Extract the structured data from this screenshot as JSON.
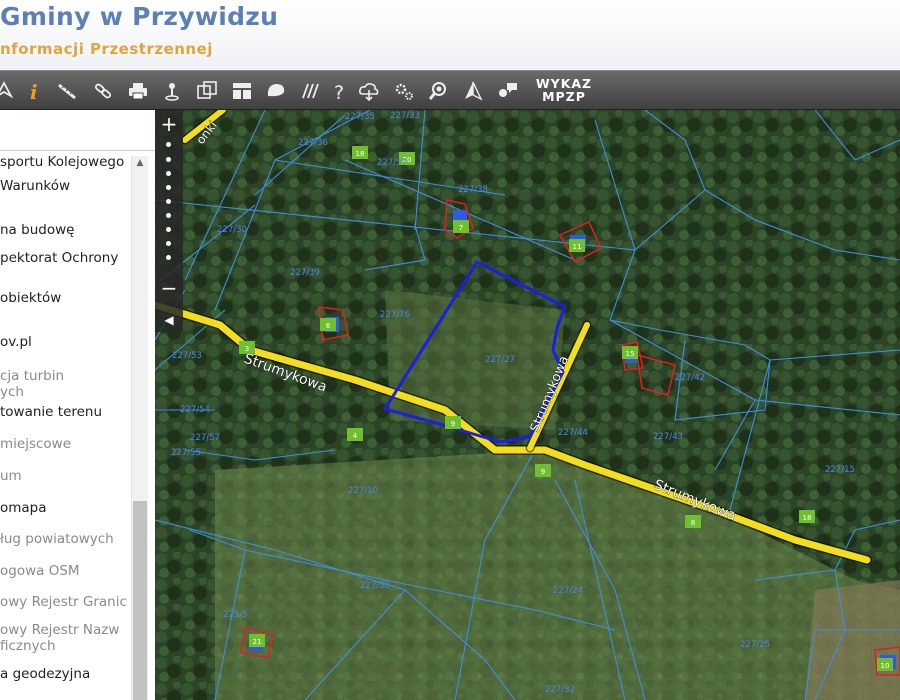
{
  "header": {
    "title": "Gminy w Przywidzu",
    "subtitle": "nformacji Przestrzennej"
  },
  "toolbar": {
    "tools": [
      {
        "name": "pan-icon"
      },
      {
        "name": "info-icon"
      },
      {
        "name": "measure-icon"
      },
      {
        "name": "link-icon"
      },
      {
        "name": "print-icon"
      },
      {
        "name": "pin-icon"
      },
      {
        "name": "copy-map-icon"
      },
      {
        "name": "layout-icon"
      },
      {
        "name": "shape-icon"
      },
      {
        "name": "hatch-icon"
      },
      {
        "name": "help-icon"
      },
      {
        "name": "cloud-download-icon"
      },
      {
        "name": "settings-icon"
      },
      {
        "name": "search-zoom-icon"
      },
      {
        "name": "north-arrow-icon"
      },
      {
        "name": "chat-icon"
      }
    ],
    "wykaz_label_1": "WYKAZ",
    "wykaz_label_2": "MPZP"
  },
  "sidebar": {
    "layers": [
      {
        "text": "sportu Kolejowego",
        "dim": false
      },
      {
        "text": "Warunków",
        "dim": false
      },
      {
        "text": "na budowę",
        "dim": false
      },
      {
        "text": "pektorat Ochrony",
        "dim": false
      },
      {
        "text": "obiektów",
        "dim": false
      },
      {
        "text": "ov.pl",
        "dim": false
      },
      {
        "text": "cja turbin",
        "dim": true
      },
      {
        "text": "ych",
        "dim": true
      },
      {
        "text": "towanie terenu",
        "dim": false
      },
      {
        "text": "miejscowe",
        "dim": true
      },
      {
        "text": "um",
        "dim": true
      },
      {
        "text": "omapa",
        "dim": false
      },
      {
        "text": "ług powiatowych",
        "dim": true
      },
      {
        "text": "ogowa OSM",
        "dim": true
      },
      {
        "text": "owy Rejestr Granic",
        "dim": true
      },
      {
        "text": "owy Rejestr Nazw",
        "dim": true
      },
      {
        "text": "ficznych",
        "dim": true
      },
      {
        "text": "a geodezyjna",
        "dim": false
      }
    ]
  },
  "map": {
    "streets": {
      "main": "Strumykowa",
      "side": "Strumykowa",
      "north": "onki"
    },
    "parcels": [
      "227/35",
      "227/33",
      "227/36",
      "227/37",
      "227/38",
      "227/30",
      "227/39",
      "227/76",
      "227/27",
      "227/53",
      "227/54",
      "227/57",
      "227/55",
      "227/42",
      "227/43",
      "227/44",
      "227/10",
      "227/15",
      "227/58",
      "227/24",
      "225/5",
      "227/25",
      "227/32"
    ],
    "house_numbers": [
      "18",
      "20",
      "7",
      "11",
      "6",
      "3",
      "15",
      "9",
      "4",
      "9",
      "8",
      "18",
      "21",
      "10"
    ],
    "colors": {
      "parcel_lines": "#3f8fe0",
      "road": "#f4dd1c",
      "selected_parcel": "#1a1fe0",
      "building": "#e02020",
      "house_label": "#6fbf2f"
    }
  }
}
